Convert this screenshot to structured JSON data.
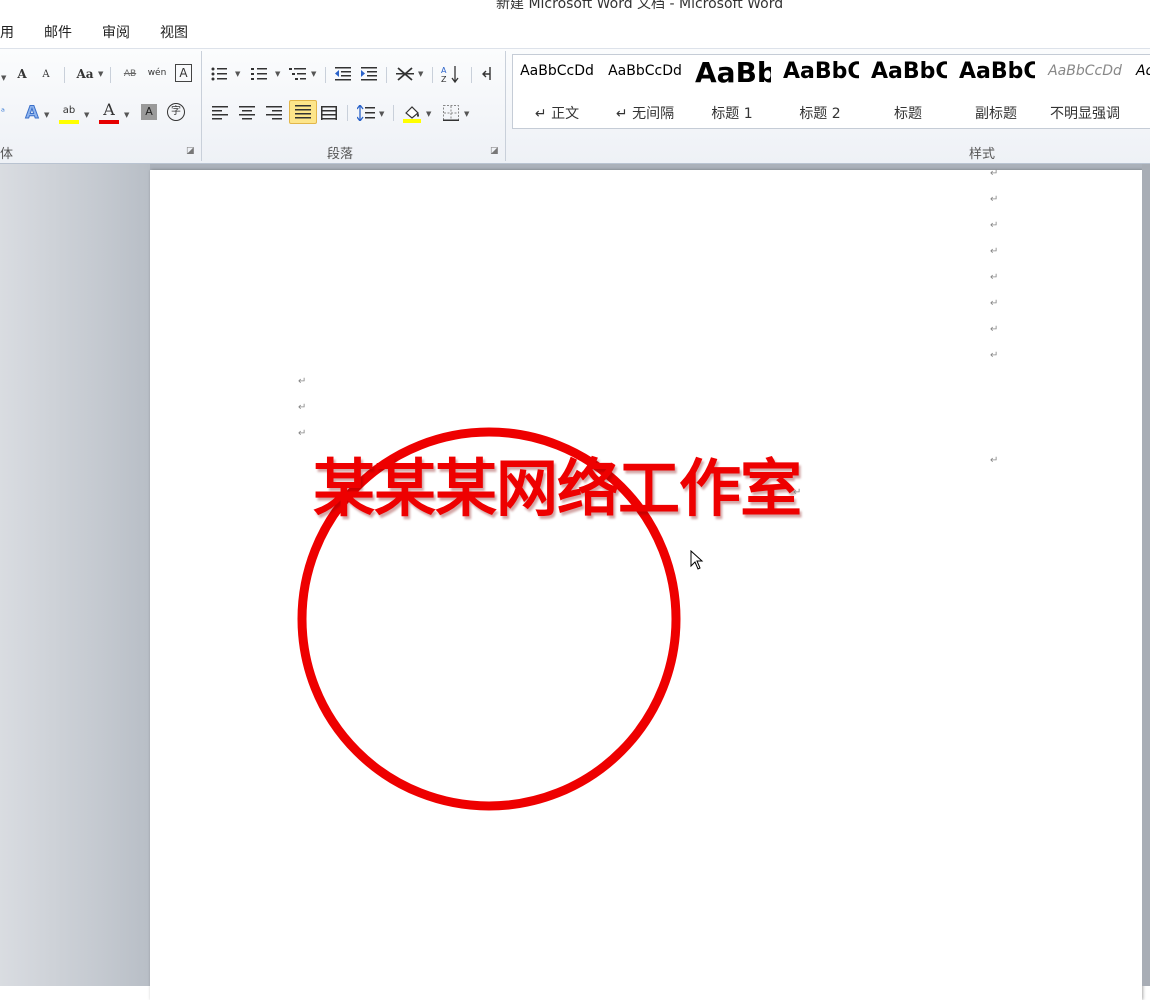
{
  "window": {
    "title": "新建 Microsoft Word 文档 - Microsoft Word"
  },
  "tabs": [
    "用",
    "邮件",
    "审阅",
    "视图"
  ],
  "ribbon": {
    "font_group": {
      "label": "字体",
      "buttons": {
        "grow_font": "A",
        "shrink_font": "A",
        "change_case": "Aa",
        "clear_format": "AB",
        "phonetic": "wén",
        "char_border": "A",
        "text_effect": "A",
        "highlight": "ab",
        "font_color": "A",
        "char_shading": "A",
        "enclose_char": "字"
      }
    },
    "paragraph_group": {
      "label": "段落"
    },
    "styles_group": {
      "label": "样式",
      "styles": [
        {
          "preview": "AaBbCcDd",
          "name": "↵ 正文"
        },
        {
          "preview": "AaBbCcDd",
          "name": "↵ 无间隔"
        },
        {
          "preview": "AaBb",
          "name": "标题 1"
        },
        {
          "preview": "AaBbC",
          "name": "标题 2"
        },
        {
          "preview": "AaBbC",
          "name": "标题"
        },
        {
          "preview": "AaBbC",
          "name": "副标题"
        },
        {
          "preview": "AaBbCcDd",
          "name": "不明显强调"
        },
        {
          "preview": "Ac",
          "name": ""
        }
      ]
    }
  },
  "document": {
    "paragraph_mark": "↵",
    "stamp": {
      "text": "某某某网络工作室",
      "color": "#ee0000"
    }
  },
  "colors": {
    "highlight": "#ffff00",
    "font_color": "#e60000",
    "accent": "#fde58a"
  }
}
